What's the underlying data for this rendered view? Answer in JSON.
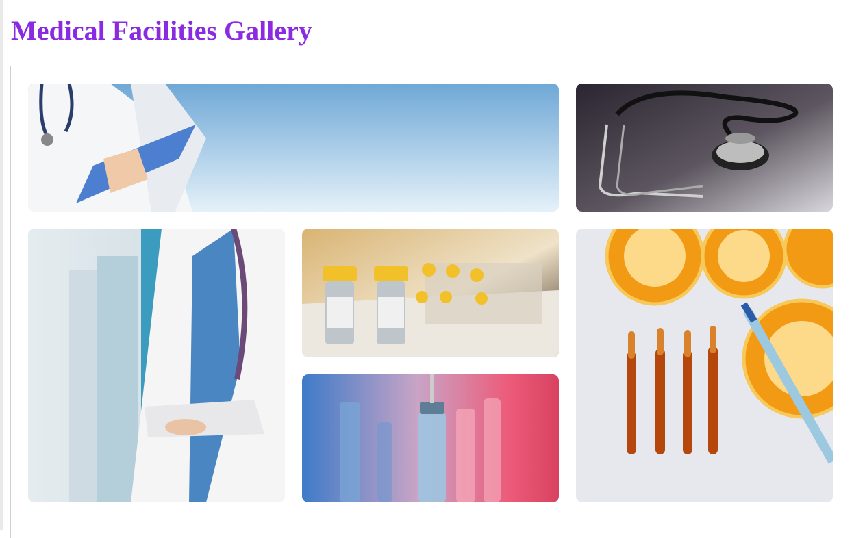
{
  "page": {
    "title": "Medical Facilities Gallery"
  },
  "colors": {
    "title": "#8a2be2",
    "frame_border": "#cfcfcf"
  },
  "gallery": {
    "images": [
      {
        "name": "doctors-banner-image",
        "subject": "doctors with clipboard and stethoscope on blue gradient banner"
      },
      {
        "name": "stethoscope-image",
        "subject": "stethoscope on dark surface"
      },
      {
        "name": "doctor-arms-crossed-image",
        "subject": "doctor in white coat with stethoscope, arms crossed"
      },
      {
        "name": "vaccine-vials-image",
        "subject": "vaccine vials with yellow caps"
      },
      {
        "name": "vial-syringe-image",
        "subject": "syringe needle in vial on blue-pink background"
      },
      {
        "name": "oranges-ampoules-image",
        "subject": "orange slices, ampoules and syringe"
      }
    ]
  }
}
